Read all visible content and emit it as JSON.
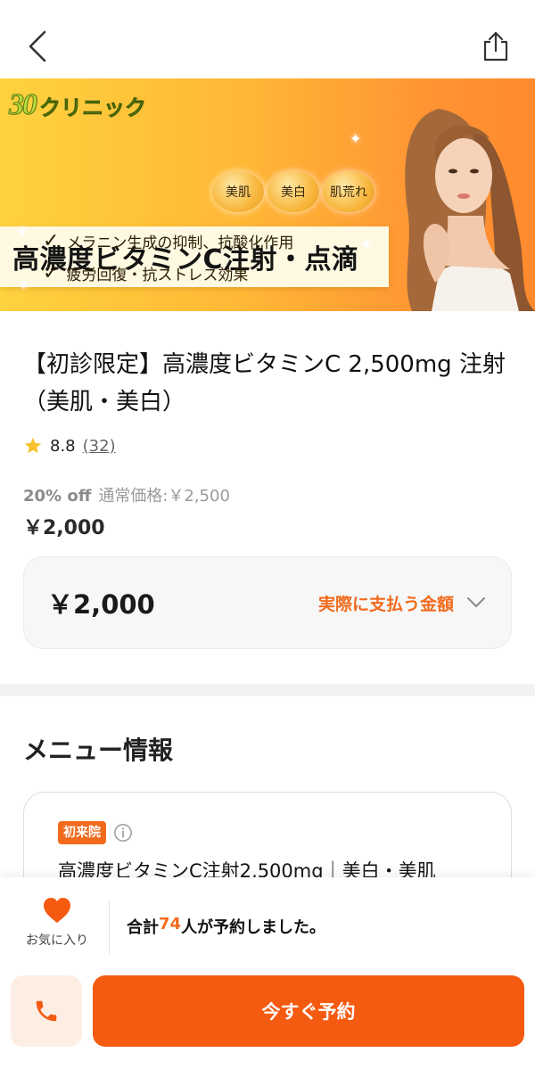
{
  "nav": {
    "back_icon": "chevron-left-icon",
    "share_icon": "share-icon"
  },
  "banner": {
    "logo_number": "30",
    "logo_text": "クリニック",
    "pills": [
      "美肌",
      "美白",
      "肌荒れ"
    ],
    "headline": "高濃度ビタミンC注射・点滴",
    "features": [
      "メラニン生成の抑制、抗酸化作用",
      "疲労回復・抗ストレス効果"
    ]
  },
  "product": {
    "title": "【初診限定】高濃度ビタミンC 2,500mg 注射（美肌・美白）",
    "rating": "8.8",
    "rating_count": "(32)",
    "discount": "20% off",
    "regular_price": "通常価格:￥2,500",
    "sale_price": "￥2,000"
  },
  "payment": {
    "amount": "￥2,000",
    "label": "実際に支払う金額"
  },
  "menu": {
    "section_title": "メニュー情報",
    "badge": "初来院",
    "item_name": "高濃度ビタミンC注射2,500mg｜美白・美肌"
  },
  "bottom": {
    "favorite_label": "お気に入り",
    "booked_prefix": "合計",
    "booked_count": "74",
    "booked_suffix": "人が予約しました。",
    "reserve_label": "今すぐ予約"
  },
  "colors": {
    "accent": "#f26b1d",
    "reserve_button": "#f45a10",
    "call_button_bg": "#fdeee4"
  }
}
